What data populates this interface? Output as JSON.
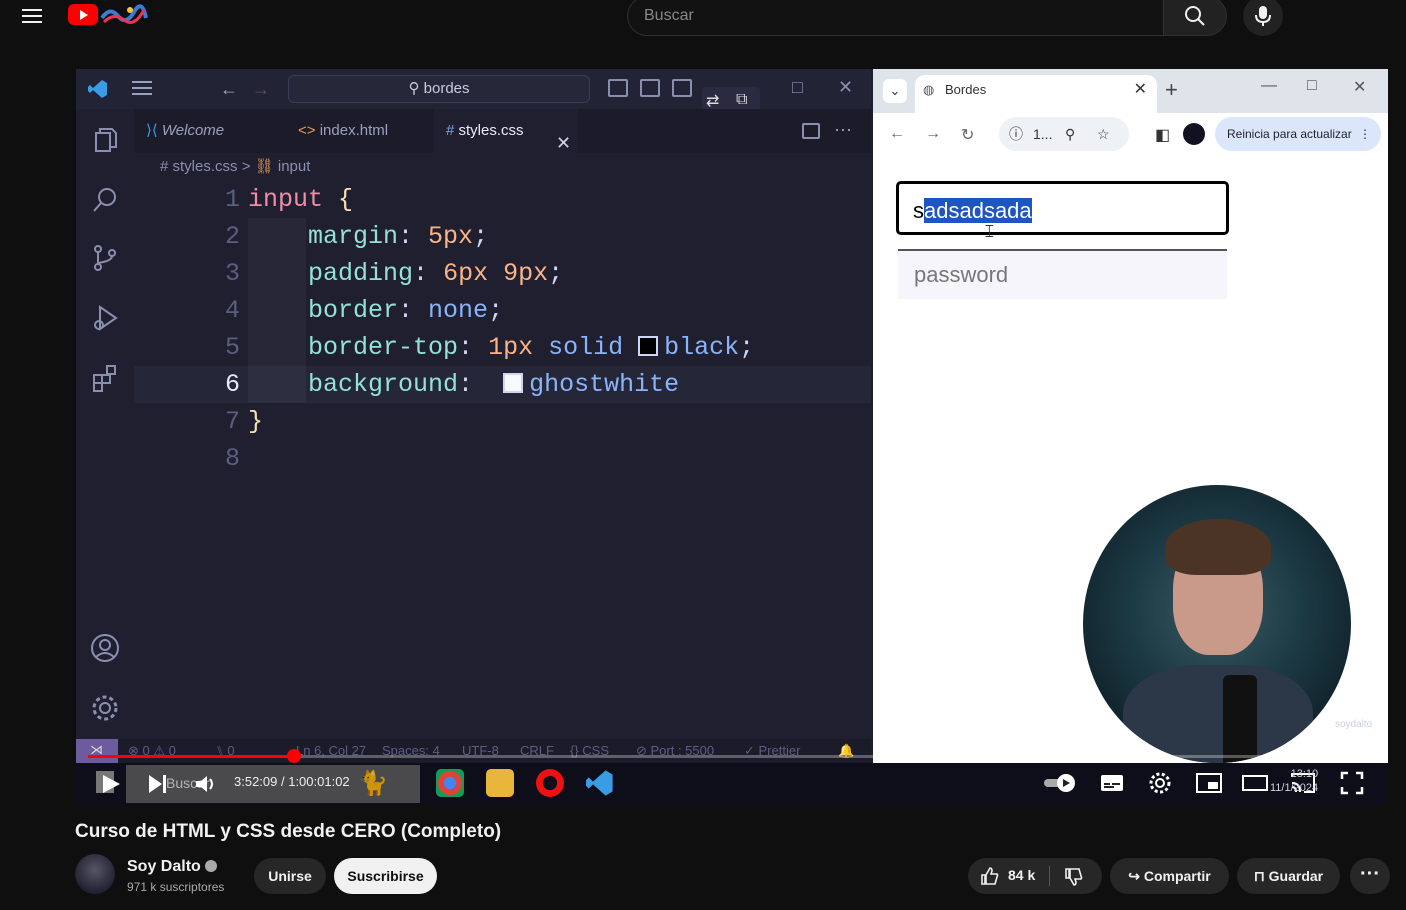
{
  "search": {
    "placeholder": "Buscar"
  },
  "vscode": {
    "search_text": "bordes",
    "tabs": [
      {
        "label": "Welcome"
      },
      {
        "label": "index.html"
      },
      {
        "label": "styles.css"
      }
    ],
    "breadcrumb": {
      "file": "styles.css",
      "symbol": "input"
    },
    "line_numbers": [
      "1",
      "2",
      "3",
      "4",
      "5",
      "6",
      "7",
      "8"
    ],
    "code": {
      "l1_sel": "input",
      "l1_brace": "{",
      "l2_prop": "margin",
      "l2_val": "5px",
      "l3_prop": "padding",
      "l3_val1": "6px",
      "l3_val2": "9px",
      "l4_prop": "border",
      "l4_val": "none",
      "l5_prop": "border-top",
      "l5_val1": "1px",
      "l5_val2": "solid",
      "l5_val3": "black",
      "l6_prop": "background",
      "l6_val": "ghostwhite",
      "l7_brace": "}"
    },
    "status": {
      "problems": "⊗ 0 ⚠ 0",
      "ports": "⑊ 0",
      "position": "Ln 6, Col 27",
      "spaces": "Spaces: 4",
      "encoding": "UTF-8",
      "eol": "CRLF",
      "language": "{} CSS",
      "port": "⊘ Port : 5500",
      "prettier": "✓ Prettier"
    }
  },
  "browser": {
    "tab_title": "Bordes",
    "address": "1...",
    "update_button": "Reinicia para actualizar",
    "input_text_first": "s",
    "input_text_selected": "adsadsada",
    "password_placeholder": "password",
    "watermark": "soydalto"
  },
  "player": {
    "time_current": "3:52:09",
    "time_total": "1:00:01:02",
    "progress_fraction": 0.16,
    "taskbar_search": "Buscar",
    "clock_time": "13:10",
    "clock_date": "11/1/2024"
  },
  "video": {
    "title": "Curso de HTML y CSS desde CERO (Completo)",
    "channel": "Soy Dalto",
    "subscribers": "971 k suscriptores",
    "join": "Unirse",
    "subscribe": "Suscribirse",
    "likes": "84 k",
    "share": "Compartir",
    "save": "Guardar"
  },
  "colors": {
    "accent": "#ff0000",
    "vscode_bg": "#1f1f30",
    "selection": "#1f55c2"
  }
}
